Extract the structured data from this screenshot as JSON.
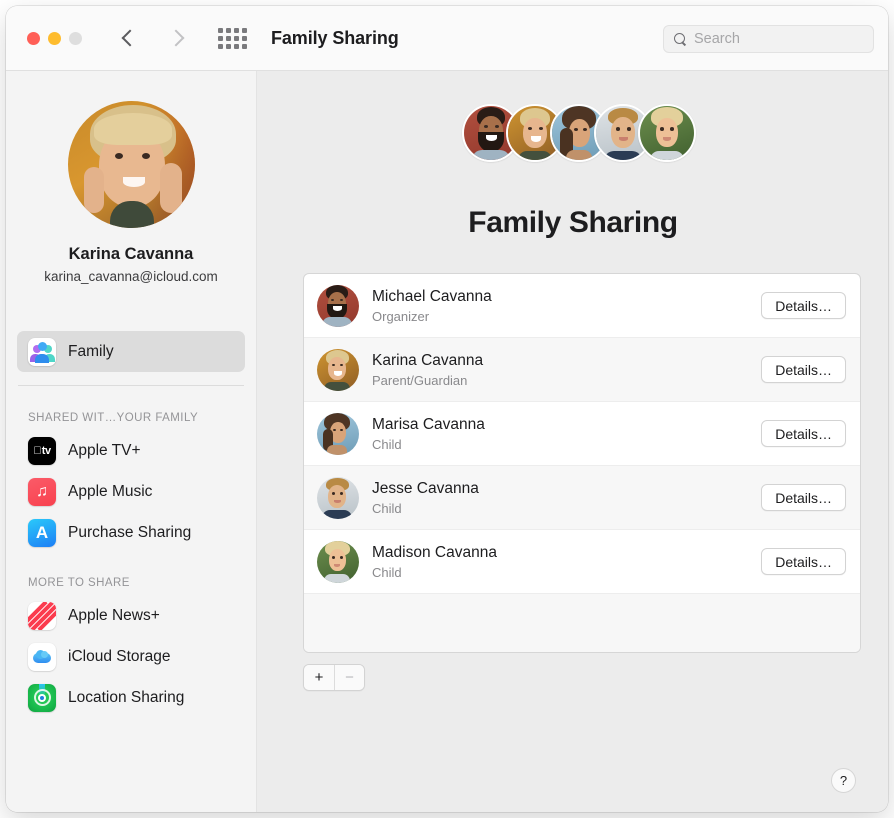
{
  "window": {
    "title": "Family Sharing",
    "traffic_lights": [
      "close-red",
      "minimize-yellow",
      "zoom-gray-disabled"
    ],
    "nav": {
      "back": "back-chevron",
      "forward": "forward-chevron-disabled"
    },
    "grid_icon": "show-all-grid-icon"
  },
  "search": {
    "placeholder": "Search",
    "value": "",
    "icon": "search-icon"
  },
  "sidebar": {
    "profile": {
      "name": "Karina Cavanna",
      "email": "karina_cavanna@icloud.com",
      "avatar": "karina-avatar"
    },
    "selected": {
      "label": "Family",
      "icon": "family-icon"
    },
    "sections": [
      {
        "header": "SHARED WIT…YOUR FAMILY",
        "items": [
          {
            "label": "Apple TV+",
            "icon": "apple-tv-icon"
          },
          {
            "label": "Apple Music",
            "icon": "apple-music-icon"
          },
          {
            "label": "Purchase Sharing",
            "icon": "app-store-icon"
          }
        ]
      },
      {
        "header": "MORE TO SHARE",
        "items": [
          {
            "label": "Apple News+",
            "icon": "apple-news-icon"
          },
          {
            "label": "iCloud Storage",
            "icon": "icloud-icon"
          },
          {
            "label": "Location Sharing",
            "icon": "find-my-icon"
          }
        ]
      }
    ]
  },
  "main": {
    "title": "Family Sharing",
    "cluster_avatars": [
      "michael-avatar",
      "karina-avatar",
      "marisa-avatar",
      "jesse-avatar",
      "madison-avatar"
    ],
    "members": [
      {
        "name": "Michael Cavanna",
        "role": "Organizer",
        "button": "Details…",
        "avatar": "michael-avatar"
      },
      {
        "name": "Karina Cavanna",
        "role": "Parent/Guardian",
        "button": "Details…",
        "avatar": "karina-avatar"
      },
      {
        "name": "Marisa Cavanna",
        "role": "Child",
        "button": "Details…",
        "avatar": "marisa-avatar"
      },
      {
        "name": "Jesse Cavanna",
        "role": "Child",
        "button": "Details…",
        "avatar": "jesse-avatar"
      },
      {
        "name": "Madison Cavanna",
        "role": "Child",
        "button": "Details…",
        "avatar": "madison-avatar"
      }
    ],
    "add_button": "+",
    "remove_button": "−",
    "help_button": "?"
  },
  "colors": {
    "window_bg": "#ececec",
    "sidebar_bg": "#f4f4f4",
    "toolbar_bg": "#fafafa",
    "list_bg": "#ffffff",
    "row_alt_bg": "#f7f7f7",
    "text_primary": "#1d1d1f",
    "text_secondary": "#89898c",
    "selection_bg": "#dcdcdc",
    "light_red": "#ff5f57",
    "light_yellow": "#febc2e",
    "light_gray": "#dedede"
  }
}
